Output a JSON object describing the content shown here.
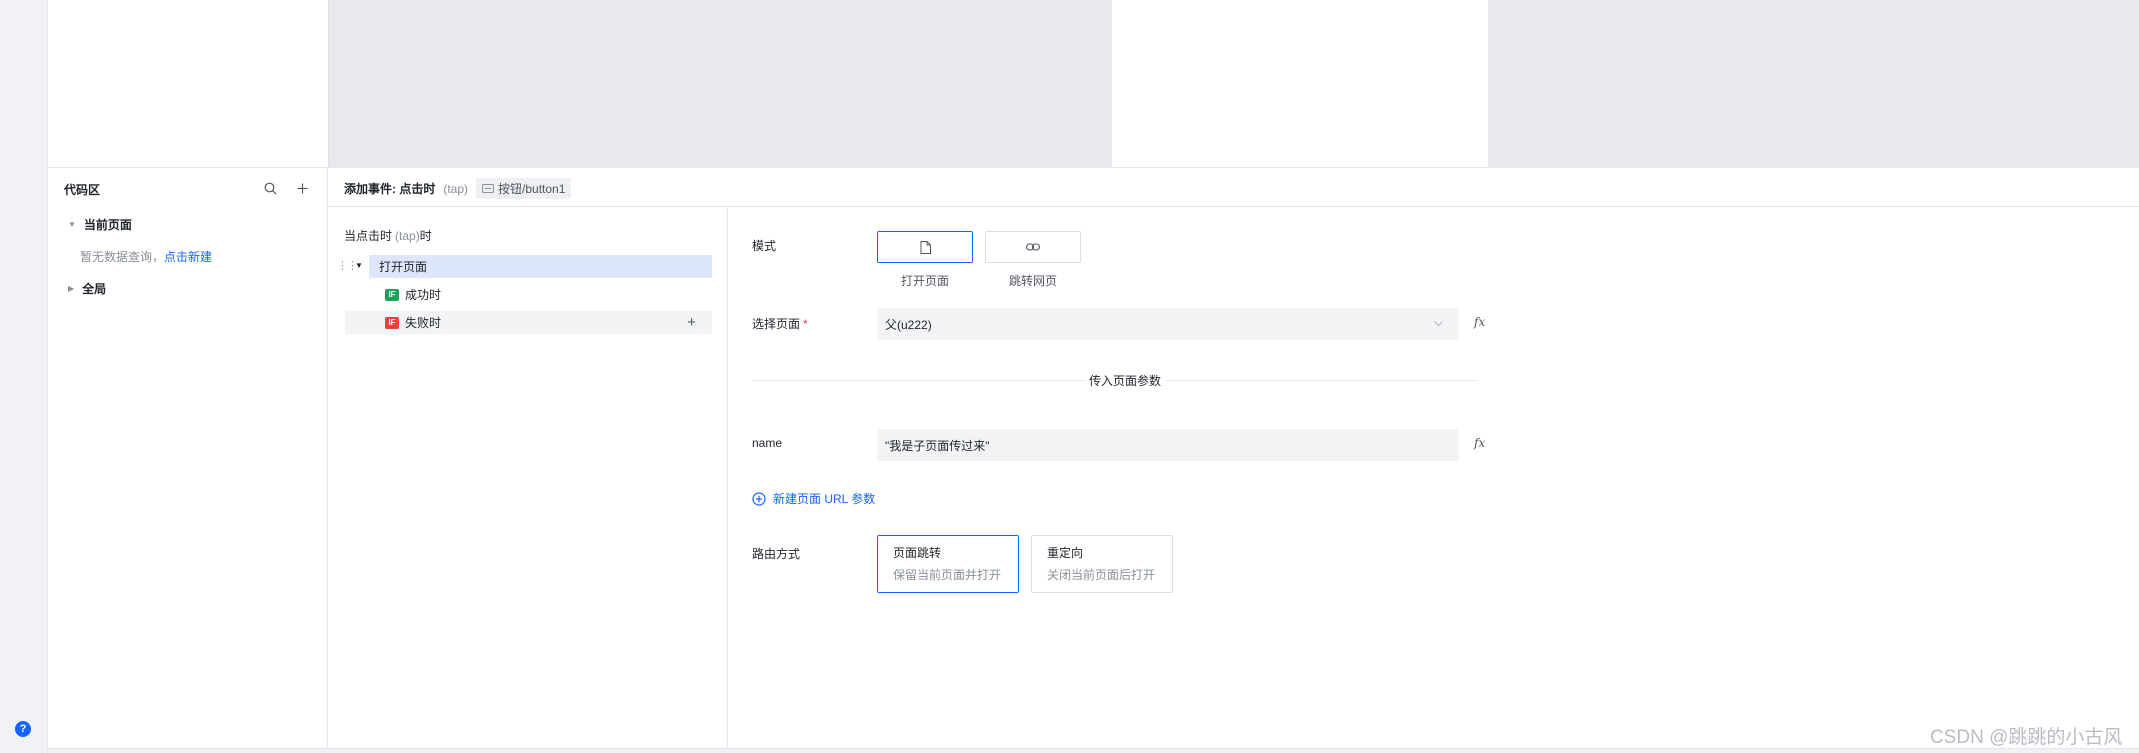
{
  "help": {
    "glyph": "?"
  },
  "code_panel": {
    "title": "代码区",
    "search_icon": "search-icon",
    "add_icon": "plus-icon",
    "current_page": {
      "label": "当前页面",
      "empty_text": "暂无数据查询，",
      "create_link": "点击新建"
    },
    "global": {
      "label": "全局"
    }
  },
  "event_header": {
    "prefix": "添加事件: 点击时",
    "event_code": "(tap)",
    "component_tag": "按钮/button1"
  },
  "event_list": {
    "trigger_label_prefix": "当点击时",
    "trigger_code": "(tap)",
    "trigger_label_suffix": "时",
    "action": "打开页面",
    "success": {
      "badge": "IF",
      "label": "成功时",
      "color": "#1aa55a"
    },
    "fail": {
      "badge": "IF",
      "label": "失败时",
      "color": "#e8413c"
    },
    "add_glyph": "+"
  },
  "form": {
    "mode_label": "模式",
    "modes": [
      {
        "caption": "打开页面",
        "icon": "file-icon",
        "selected": true
      },
      {
        "caption": "跳转网页",
        "icon": "link-icon",
        "selected": false
      }
    ],
    "select_page_label": "选择页面",
    "required_mark": "*",
    "select_page_value": "父(u222)",
    "fx": "fx",
    "divider_text": "传入页面参数",
    "param_name": "name",
    "param_value": "\"我是子页面传过来\"",
    "add_param": "新建页面 URL 参数",
    "route_label": "路由方式",
    "routes": [
      {
        "title": "页面跳转",
        "desc": "保留当前页面并打开",
        "selected": true
      },
      {
        "title": "重定向",
        "desc": "关闭当前页面后打开",
        "selected": false
      }
    ]
  },
  "watermark": "CSDN @跳跳的小古风",
  "colors": {
    "accent": "#1664ff",
    "canvas_grey": "#e8e9ee",
    "selected_row": "#dde6fb"
  }
}
